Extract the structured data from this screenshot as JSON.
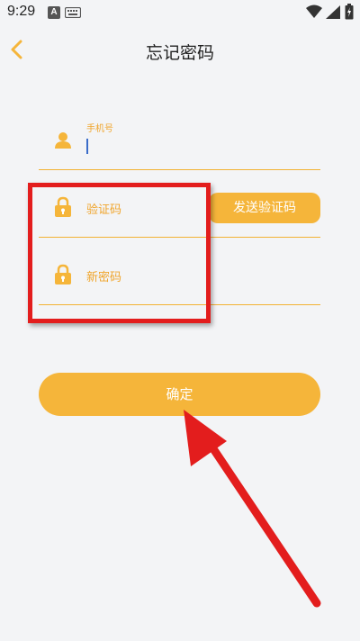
{
  "status_bar": {
    "time": "9:29",
    "notification_letter": "A",
    "icons": [
      "keyboard-icon",
      "wifi-icon",
      "signal-icon",
      "battery-icon"
    ]
  },
  "header": {
    "title": "忘记密码",
    "back_icon": "chevron-left-icon"
  },
  "form": {
    "phone": {
      "label": "手机号",
      "value": "",
      "icon": "user-icon"
    },
    "code": {
      "placeholder": "验证码",
      "icon": "lock-icon"
    },
    "new_password": {
      "placeholder": "新密码",
      "icon": "lock-icon"
    },
    "send_code_label": "发送验证码",
    "confirm_label": "确定"
  },
  "colors": {
    "accent": "#f5b53a",
    "label": "#f0a52c",
    "background": "#f3f4f6",
    "annotation": "#e31d1d"
  }
}
